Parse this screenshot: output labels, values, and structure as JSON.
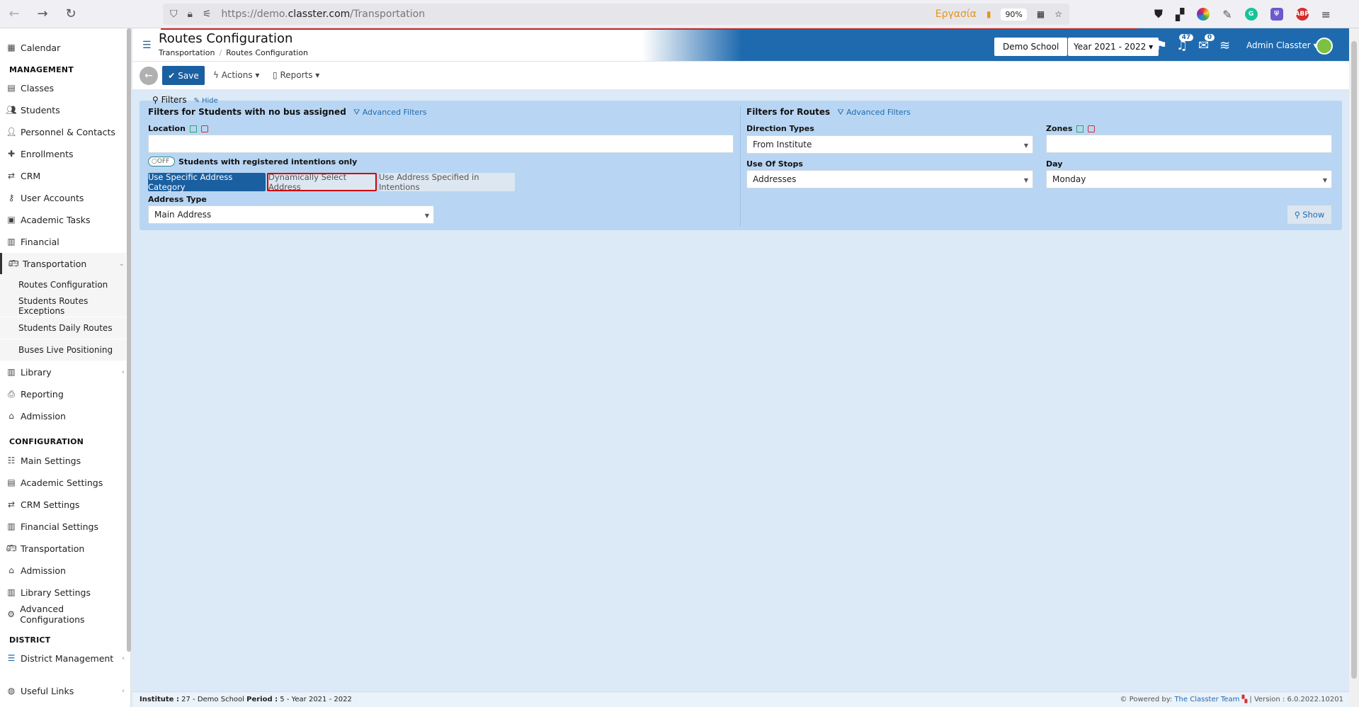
{
  "browser": {
    "url_prefix": "https://demo.",
    "url_domain": "classter.com",
    "url_path": "/Transportation",
    "ergasia": "Εργασία",
    "zoom": "90%"
  },
  "header": {
    "title": "Routes Configuration",
    "breadcrumb_1": "Transportation",
    "breadcrumb_2": "Routes Configuration",
    "school": "Demo School",
    "year": "Year 2021 - 2022 ▾",
    "notif_count": "47",
    "mail_count": "0",
    "admin": "Admin Classter ▾"
  },
  "toolbar": {
    "save": "Save",
    "actions": "Actions ▾",
    "reports": "Reports ▾"
  },
  "sidebar": {
    "calendar": "Calendar",
    "section_management": "MANAGEMENT",
    "classes": "Classes",
    "students": "Students",
    "personnel": "Personnel & Contacts",
    "enrollments": "Enrollments",
    "crm": "CRM",
    "user_accounts": "User Accounts",
    "academic_tasks": "Academic Tasks",
    "financial": "Financial",
    "transportation": "Transportation",
    "sub_routes": "Routes Configuration",
    "sub_exceptions": "Students Routes Exceptions",
    "sub_daily": "Students Daily Routes",
    "sub_live": "Buses Live Positioning",
    "library": "Library",
    "reporting": "Reporting",
    "admission": "Admission",
    "section_configuration": "CONFIGURATION",
    "main_settings": "Main Settings",
    "academic_settings": "Academic Settings",
    "crm_settings": "CRM Settings",
    "financial_settings": "Financial Settings",
    "transportation_cfg": "Transportation",
    "admission_cfg": "Admission",
    "library_settings": "Library Settings",
    "advanced_config": "Advanced Configurations",
    "section_district": "DISTRICT",
    "district_mgmt": "District Management",
    "useful_links": "Useful Links"
  },
  "filters": {
    "title": "Filters",
    "hide": "Hide",
    "students_title": "Filters for Students with no bus assigned",
    "advanced": "Advanced Filters",
    "location_label": "Location",
    "location_value": "",
    "toggle_text": "OFF",
    "toggle_label": "Students with registered intentions only",
    "seg_specific": "Use Specific Address Category",
    "seg_dynamic": "Dynamically Select Address",
    "seg_intentions": "Use Address Specified in Intentions",
    "address_type_label": "Address Type",
    "address_type_value": "Main Address",
    "routes_title": "Filters for Routes",
    "direction_label": "Direction Types",
    "direction_value": "From Institute",
    "zones_label": "Zones",
    "zones_value": "",
    "stops_label": "Use Of Stops",
    "stops_value": "Addresses",
    "day_label": "Day",
    "day_value": "Monday",
    "show": "Show"
  },
  "footer": {
    "institute_label": "Institute :",
    "institute_value": "27 - Demo School",
    "period_label": "Period :",
    "period_value": "5 - Year 2021 - 2022",
    "powered": "Powered by:",
    "team": "The Classter Team",
    "version": "| Version : 6.0.2022.10201"
  },
  "colors": {
    "primary": "#1a5fa0",
    "header_blue": "#1f6aaf",
    "panel": "#b8d6f3",
    "page_bg": "#dceaf7",
    "highlight": "#d00000"
  }
}
